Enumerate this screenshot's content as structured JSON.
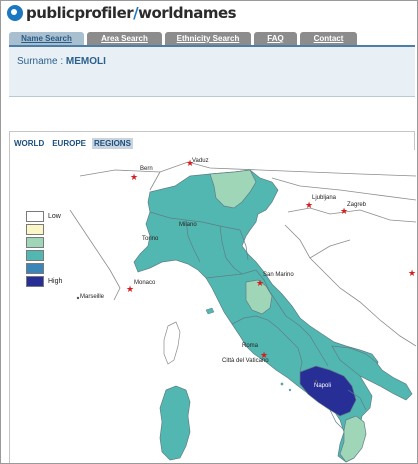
{
  "logo": {
    "brand": "publicprofiler",
    "slash": "/",
    "product": "worldnames"
  },
  "tabs": [
    {
      "label": "Name Search"
    },
    {
      "label": "Area Search"
    },
    {
      "label": "Ethnicity Search"
    },
    {
      "label": "FAQ"
    },
    {
      "label": "Contact"
    }
  ],
  "surname": {
    "prefix": "Surname : ",
    "value": "MEMOLI"
  },
  "map_tabs": [
    {
      "label": "WORLD"
    },
    {
      "label": "EUROPE"
    },
    {
      "label": "REGIONS"
    }
  ],
  "legend": {
    "low": "Low",
    "high": "High",
    "colors": [
      "#ffffff",
      "#fbf6c6",
      "#9fd6b8",
      "#52b7b0",
      "#3a86b8",
      "#272e96"
    ]
  },
  "colors": {
    "sea": "#ffffff",
    "foreign_land": "#ffffff",
    "border": "#8c8c8c",
    "tab_active": "#a8bfd0",
    "tab_inactive": "#8c8c8c",
    "brand_blue": "#1a77c0",
    "capital_star": "#d11f1f"
  },
  "cities": [
    {
      "label": "Bern"
    },
    {
      "label": "Vaduz"
    },
    {
      "label": "Ljubljana"
    },
    {
      "label": "Zagreb"
    },
    {
      "label": "Milano"
    },
    {
      "label": "Torino"
    },
    {
      "label": "Monaco"
    },
    {
      "label": "Marseille"
    },
    {
      "label": "San Marino"
    },
    {
      "label": "Roma"
    },
    {
      "label": "Città del Vaticano"
    },
    {
      "label": "Napoli"
    }
  ]
}
